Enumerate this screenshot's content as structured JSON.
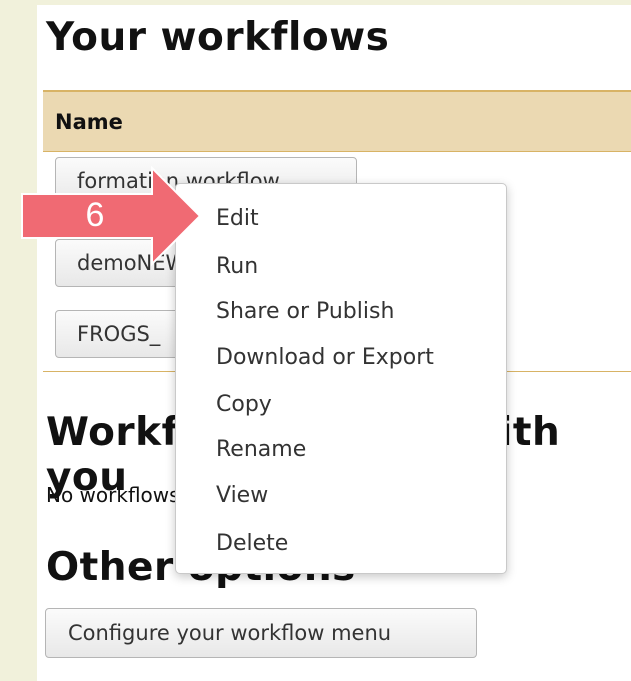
{
  "page": {
    "title": "Your workflows",
    "table_header": {
      "name": "Name"
    },
    "workflows": [
      {
        "label": "formation workflow"
      },
      {
        "label": "demoNEW"
      },
      {
        "label": "FROGS_"
      }
    ],
    "shared": {
      "title": "Workflows shared with you",
      "message": "No workflows have been shared with you."
    },
    "other": {
      "title": "Other options",
      "configure_label": "Configure your workflow menu"
    }
  },
  "context_menu": {
    "items": [
      {
        "label": "Edit"
      },
      {
        "label": "Run"
      },
      {
        "label": "Share or Publish"
      },
      {
        "label": "Download or Export"
      },
      {
        "label": "Copy"
      },
      {
        "label": "Rename"
      },
      {
        "label": "View"
      },
      {
        "label": "Delete"
      }
    ]
  },
  "annotation": {
    "step_number": "6",
    "arrow_color": "#f06a73"
  }
}
